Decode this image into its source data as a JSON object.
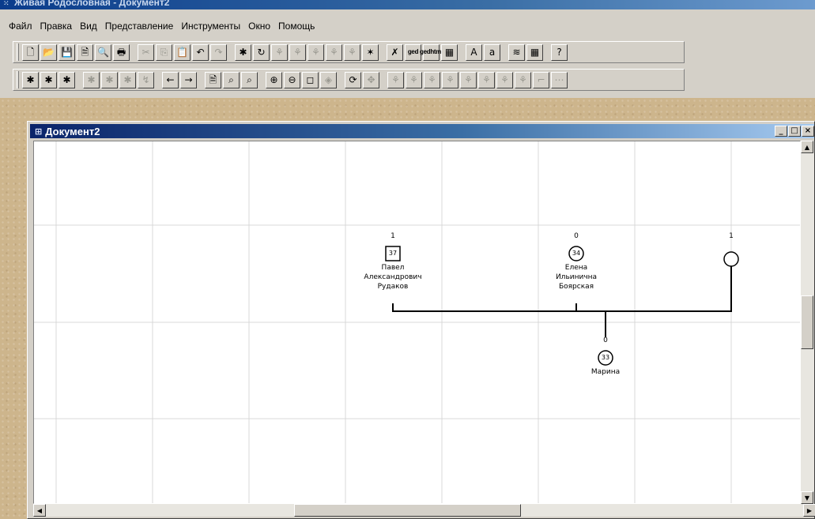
{
  "app": {
    "title": "Живая Родословная - Документ2"
  },
  "menu": [
    "Файл",
    "Правка",
    "Вид",
    "Представление",
    "Инструменты",
    "Окно",
    "Помощь"
  ],
  "toolbar1": {
    "buttons": [
      {
        "name": "new-icon",
        "glyph": "🗋"
      },
      {
        "name": "open-icon",
        "glyph": "📂"
      },
      {
        "name": "save-icon",
        "glyph": "💾"
      },
      {
        "name": "page-icon",
        "glyph": "🗎"
      },
      {
        "name": "preview-icon",
        "glyph": "🔍"
      },
      {
        "name": "print-icon",
        "glyph": "🖶"
      },
      {
        "name": "cut-icon",
        "glyph": "✂",
        "dis": true
      },
      {
        "name": "copy-icon",
        "glyph": "⎘",
        "dis": true
      },
      {
        "name": "paste-icon",
        "glyph": "📋"
      },
      {
        "name": "undo-icon",
        "glyph": "↶"
      },
      {
        "name": "redo-icon",
        "glyph": "↷",
        "dis": true
      },
      {
        "name": "add-person-icon",
        "glyph": "✱"
      },
      {
        "name": "add-relation-icon",
        "glyph": "↻"
      },
      {
        "name": "tree-icon-1",
        "glyph": "⚘",
        "dis": true
      },
      {
        "name": "tree-icon-2",
        "glyph": "⚘",
        "dis": true
      },
      {
        "name": "tree-icon-3",
        "glyph": "⚘",
        "dis": true
      },
      {
        "name": "tree-icon-4",
        "glyph": "⚘",
        "dis": true
      },
      {
        "name": "tree-icon-5",
        "glyph": "⚘",
        "dis": true
      },
      {
        "name": "wizard-icon",
        "glyph": "✶"
      },
      {
        "name": "tools-icon",
        "glyph": "✗"
      },
      {
        "name": "ged-export-icon",
        "glyph": "ged",
        "small": true
      },
      {
        "name": "ged-html-icon",
        "glyph": "gedhtml",
        "small": true
      },
      {
        "name": "chart-icon",
        "glyph": "▦"
      },
      {
        "name": "font-larger-icon",
        "glyph": "A"
      },
      {
        "name": "font-smaller-icon",
        "glyph": "a"
      },
      {
        "name": "layers-icon",
        "glyph": "≋"
      },
      {
        "name": "grid-icon",
        "glyph": "▦"
      },
      {
        "name": "help-icon",
        "glyph": "?"
      }
    ]
  },
  "toolbar2": {
    "buttons": [
      {
        "name": "add-parent-icon",
        "glyph": "✱"
      },
      {
        "name": "add-sibling-icon",
        "glyph": "✱"
      },
      {
        "name": "add-child-icon",
        "glyph": "✱"
      },
      {
        "name": "link-parent-icon",
        "glyph": "✱",
        "dis": true
      },
      {
        "name": "link-sibling-icon",
        "glyph": "✱",
        "dis": true
      },
      {
        "name": "link-child-icon",
        "glyph": "✱",
        "dis": true
      },
      {
        "name": "link-spouse-icon",
        "glyph": "↯",
        "dis": true
      },
      {
        "name": "back-icon",
        "glyph": "←"
      },
      {
        "name": "forward-icon",
        "glyph": "→"
      },
      {
        "name": "card-icon",
        "glyph": "🗎"
      },
      {
        "name": "find-icon",
        "glyph": "⌕"
      },
      {
        "name": "find-next-icon",
        "glyph": "⌕"
      },
      {
        "name": "zoom-in-icon",
        "glyph": "⊕"
      },
      {
        "name": "zoom-out-icon",
        "glyph": "⊖"
      },
      {
        "name": "zoom-fit-icon",
        "glyph": "◻"
      },
      {
        "name": "zoom-page-icon",
        "glyph": "◈",
        "dis": true
      },
      {
        "name": "refresh-icon",
        "glyph": "⟳"
      },
      {
        "name": "center-icon",
        "glyph": "✥",
        "dis": true
      },
      {
        "name": "layout-icon-1",
        "glyph": "⚘",
        "dis": true
      },
      {
        "name": "layout-icon-2",
        "glyph": "⚘",
        "dis": true
      },
      {
        "name": "layout-icon-3",
        "glyph": "⚘",
        "dis": true
      },
      {
        "name": "layout-icon-4",
        "glyph": "⚘",
        "dis": true
      },
      {
        "name": "layout-icon-5",
        "glyph": "⚘",
        "dis": true
      },
      {
        "name": "layout-icon-6",
        "glyph": "⚘",
        "dis": true
      },
      {
        "name": "layout-icon-7",
        "glyph": "⚘",
        "dis": true
      },
      {
        "name": "layout-icon-8",
        "glyph": "⚘",
        "dis": true
      },
      {
        "name": "layout-icon-9",
        "glyph": "⌐",
        "dis": true
      },
      {
        "name": "layout-icon-10",
        "glyph": "⋯",
        "dis": true
      }
    ]
  },
  "document": {
    "title": "Документ2",
    "controls": {
      "minimize": "_",
      "maximize": "□",
      "close": "×"
    }
  },
  "tree": {
    "people": [
      {
        "id": "pavel",
        "count": "1",
        "number": "37",
        "sex": "male",
        "name_lines": [
          "Павел",
          "Александрович",
          "Рудаков"
        ]
      },
      {
        "id": "elena",
        "count": "0",
        "number": "34",
        "sex": "female",
        "name_lines": [
          "Елена",
          "Ильинична",
          "Боярская"
        ]
      },
      {
        "id": "unknown",
        "count": "1",
        "number": "",
        "sex": "female",
        "name_lines": []
      },
      {
        "id": "marina",
        "count": "0",
        "number": "33",
        "sex": "female",
        "name_lines": [
          "Марина"
        ]
      }
    ]
  }
}
